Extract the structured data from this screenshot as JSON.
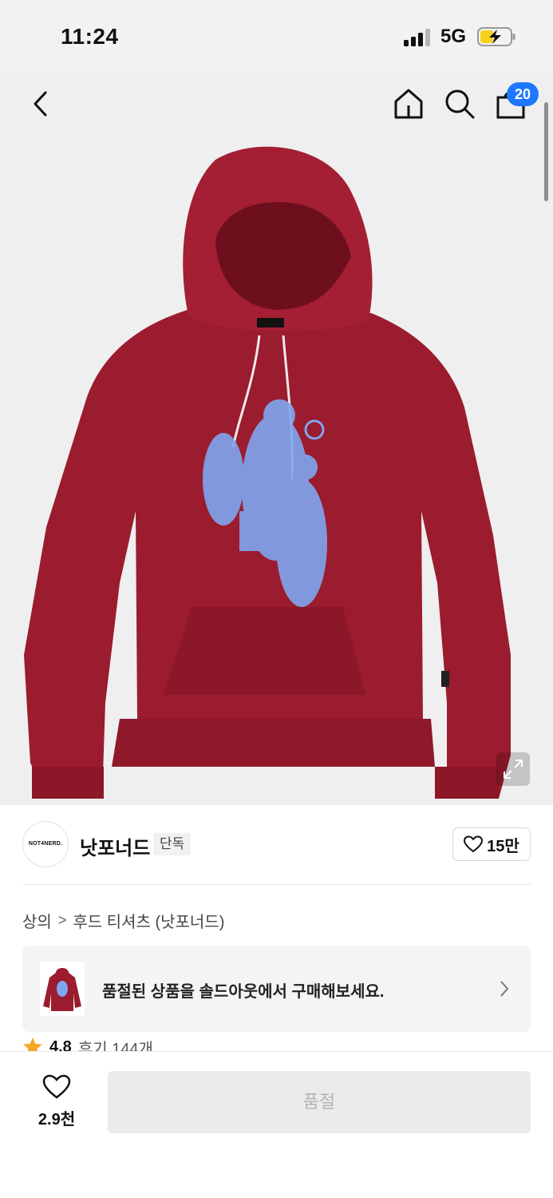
{
  "status_bar": {
    "time": "11:24",
    "network": "5G"
  },
  "nav": {
    "cart_count": "20"
  },
  "brand": {
    "logo_text": "NOT4NERD.",
    "name": "낫포너드",
    "tag": "단독",
    "likes": "15만"
  },
  "breadcrumb": {
    "category": "상의",
    "subcategory": "후드 티셔츠 (낫포너드)"
  },
  "soldout_banner": {
    "text": "품절된 상품을 솔드아웃에서 구매해보세요."
  },
  "rating": {
    "score": "4.8",
    "reviews": "후기 144개"
  },
  "bottom_bar": {
    "wish_count": "2.9천",
    "purchase_button": "품절"
  },
  "colors": {
    "accent": "#1e78ff",
    "hoodie": "#9b1c2e",
    "print": "#7fa6f0",
    "rating_star": "#f5a623"
  }
}
